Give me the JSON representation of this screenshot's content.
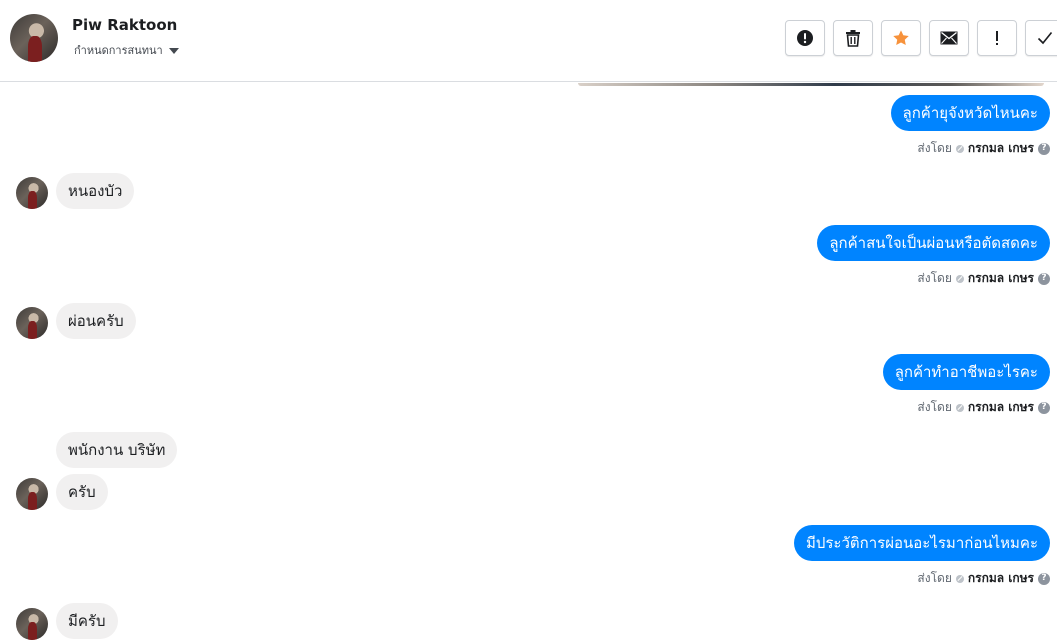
{
  "header": {
    "name": "Piw Raktoon",
    "subtitle": "กำหนดการสนทนา"
  },
  "toolbar": {
    "buttons": [
      {
        "name": "spam",
        "icon": "alert-circle-icon"
      },
      {
        "name": "delete",
        "icon": "trash-icon"
      },
      {
        "name": "star",
        "icon": "star-icon",
        "color": "#f7923b"
      },
      {
        "name": "mark-unread",
        "icon": "envelope-icon"
      },
      {
        "name": "important",
        "icon": "exclamation-icon"
      },
      {
        "name": "done",
        "icon": "check-icon"
      }
    ]
  },
  "sent_by": {
    "prefix": "ส่งโดย",
    "agent": "กรกมล เกษร",
    "help": "?"
  },
  "messages": [
    {
      "dir": "out",
      "text": "ลูกค้ายุจังหวัดไหนคะ"
    },
    {
      "dir": "in",
      "text": "หนองบัว"
    },
    {
      "dir": "out",
      "text": "ลูกค้าสนใจเป็นผ่อนหรือตัดสดคะ"
    },
    {
      "dir": "in",
      "text": "ผ่อนครับ"
    },
    {
      "dir": "out",
      "text": "ลูกค้าทำอาชีพอะไรคะ"
    },
    {
      "dir": "in",
      "text": "พนักงาน บริษัท"
    },
    {
      "dir": "in",
      "text": "ครับ"
    },
    {
      "dir": "out",
      "text": "มีประวัติการผ่อนอะไรมาก่อนไหมคะ"
    },
    {
      "dir": "in",
      "text": "มีครับ"
    }
  ],
  "colors": {
    "outgoing_bubble": "#0084ff",
    "incoming_bubble": "#f1f0f0",
    "star": "#f7923b"
  }
}
